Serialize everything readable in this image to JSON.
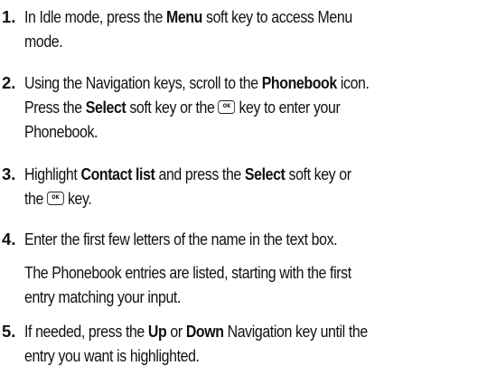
{
  "steps": [
    {
      "number": "1.",
      "lines": [
        [
          {
            "t": "In Idle mode, press the "
          },
          {
            "t": "Menu",
            "b": true
          },
          {
            "t": " soft key to access Menu"
          }
        ],
        [
          {
            "t": "mode."
          }
        ]
      ]
    },
    {
      "number": "2.",
      "lines": [
        [
          {
            "t": "Using the Navigation keys, scroll to the "
          },
          {
            "t": "Phonebook",
            "b": true
          },
          {
            "t": " icon."
          }
        ],
        [
          {
            "t": "Press the "
          },
          {
            "t": "Select",
            "b": true
          },
          {
            "t": " soft key or the "
          },
          {
            "icon": "ok-key-icon"
          },
          {
            "t": " key to enter your"
          }
        ],
        [
          {
            "t": "Phonebook."
          }
        ]
      ]
    },
    {
      "number": "3.",
      "lines": [
        [
          {
            "t": "Highlight "
          },
          {
            "t": "Contact list",
            "b": true
          },
          {
            "t": " and press the "
          },
          {
            "t": "Select",
            "b": true
          },
          {
            "t": " soft key or"
          }
        ],
        [
          {
            "t": "the "
          },
          {
            "icon": "ok-key-icon"
          },
          {
            "t": " key."
          }
        ]
      ]
    },
    {
      "number": "4.",
      "lines": [
        [
          {
            "t": "Enter the first few letters of the name in the text box."
          }
        ]
      ],
      "note": [
        [
          {
            "t": "The Phonebook entries are listed, starting with the first"
          }
        ],
        [
          {
            "t": "entry matching your input."
          }
        ]
      ]
    },
    {
      "number": "5.",
      "lines": [
        [
          {
            "t": "If needed, press the "
          },
          {
            "t": "Up",
            "b": true
          },
          {
            "t": " or "
          },
          {
            "t": "Down",
            "b": true
          },
          {
            "t": " Navigation key until the"
          }
        ],
        [
          {
            "t": "entry you want is highlighted."
          }
        ]
      ]
    }
  ]
}
